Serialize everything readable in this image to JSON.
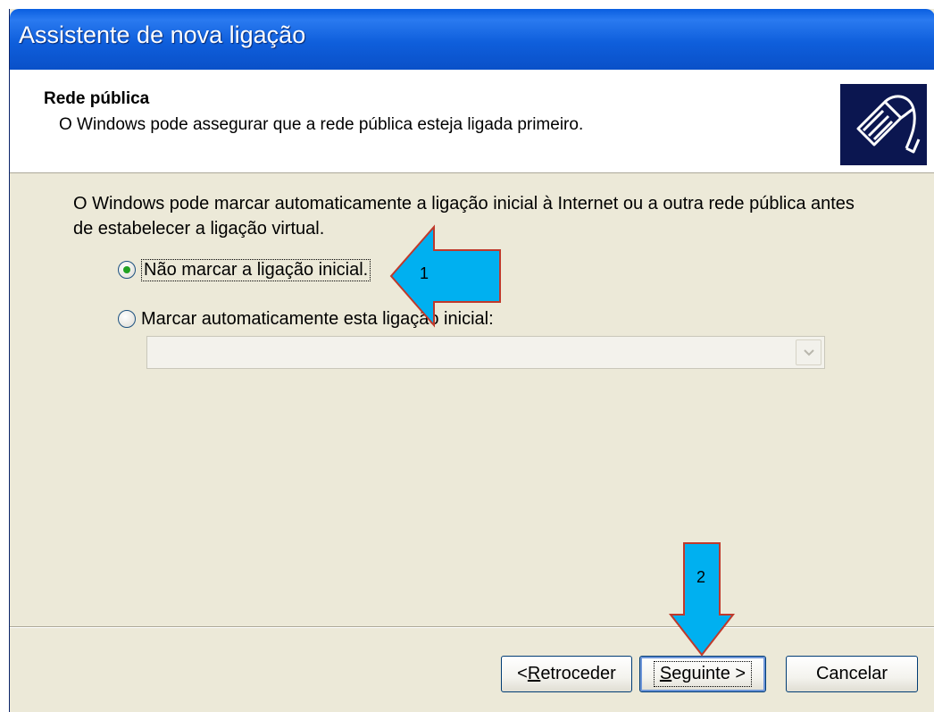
{
  "window": {
    "title": "Assistente de nova ligação"
  },
  "header": {
    "title": "Rede pública",
    "subtitle": "O Windows pode assegurar que a rede pública esteja ligada primeiro.",
    "icon": "network-cable-icon"
  },
  "body": {
    "description": "O Windows pode marcar automaticamente a ligação inicial à Internet ou a outra rede pública antes de estabelecer a ligação virtual.",
    "options": [
      {
        "label": "Não marcar a ligação inicial.",
        "selected": true
      },
      {
        "label": "Marcar automaticamente esta ligação inicial:",
        "selected": false
      }
    ],
    "dropdown_value": ""
  },
  "buttons": {
    "back": {
      "prefix": "< ",
      "mnemonic": "R",
      "rest": "etroceder"
    },
    "next": {
      "mnemonic": "S",
      "rest": "eguinte >"
    },
    "cancel": "Cancelar"
  },
  "annotations": {
    "arrow1_label": "1",
    "arrow2_label": "2",
    "arrow_color": "#00B0F0",
    "arrow_border": "#C0392B"
  }
}
